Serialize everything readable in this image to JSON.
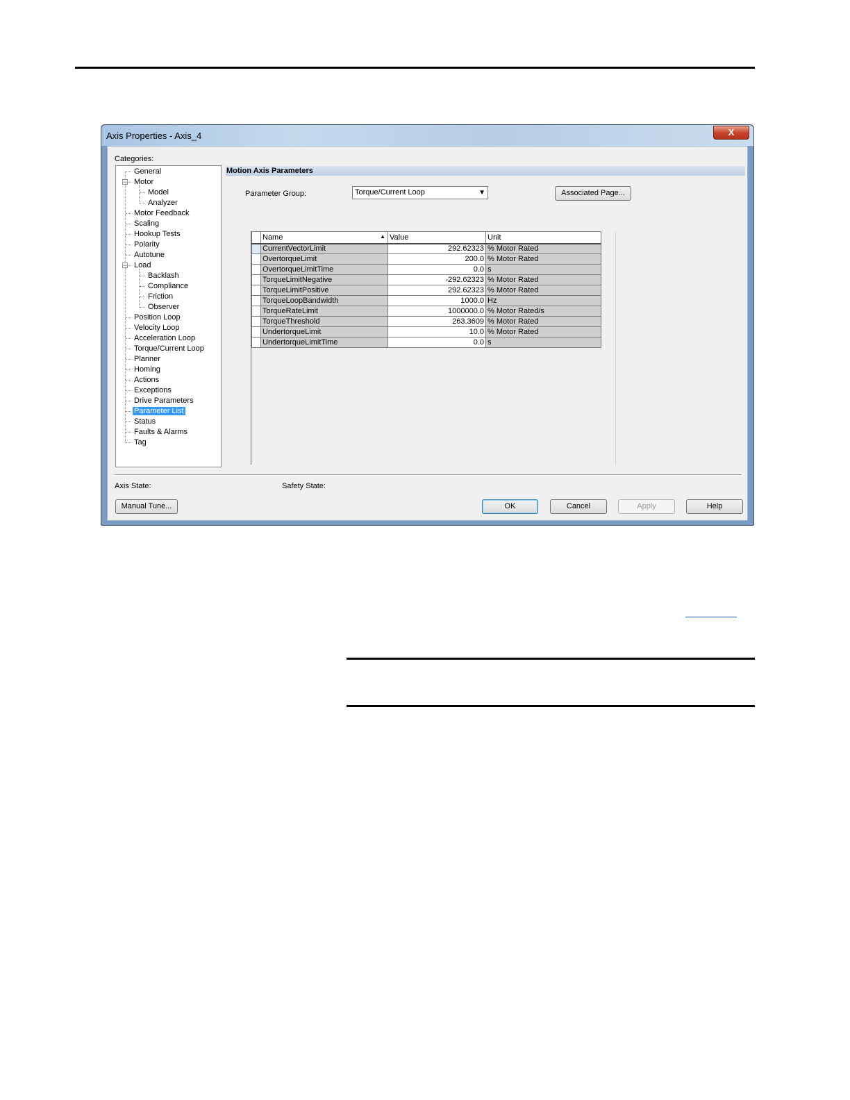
{
  "window": {
    "title": "Axis Properties - Axis_4",
    "close_label": "X"
  },
  "categories": {
    "label": "Categories:",
    "items": [
      {
        "label": "General"
      },
      {
        "label": "Motor"
      },
      {
        "label": "Model"
      },
      {
        "label": "Analyzer"
      },
      {
        "label": "Motor Feedback"
      },
      {
        "label": "Scaling"
      },
      {
        "label": "Hookup Tests"
      },
      {
        "label": "Polarity"
      },
      {
        "label": "Autotune"
      },
      {
        "label": "Load"
      },
      {
        "label": "Backlash"
      },
      {
        "label": "Compliance"
      },
      {
        "label": "Friction"
      },
      {
        "label": "Observer"
      },
      {
        "label": "Position Loop"
      },
      {
        "label": "Velocity Loop"
      },
      {
        "label": "Acceleration Loop"
      },
      {
        "label": "Torque/Current Loop"
      },
      {
        "label": "Planner"
      },
      {
        "label": "Homing"
      },
      {
        "label": "Actions"
      },
      {
        "label": "Exceptions"
      },
      {
        "label": "Drive Parameters"
      },
      {
        "label": "Parameter List"
      },
      {
        "label": "Status"
      },
      {
        "label": "Faults & Alarms"
      },
      {
        "label": "Tag"
      }
    ],
    "selected": "Parameter List"
  },
  "panel": {
    "header": "Motion Axis Parameters",
    "parameter_group_label": "Parameter Group:",
    "parameter_group_value": "Torque/Current Loop",
    "associated_page_label": "Associated Page..."
  },
  "grid": {
    "columns": [
      "Name",
      "Value",
      "Unit"
    ],
    "rows": [
      {
        "name": "CurrentVectorLimit",
        "value": "292.62323",
        "unit": "% Motor Rated"
      },
      {
        "name": "OvertorqueLimit",
        "value": "200.0",
        "unit": "% Motor Rated"
      },
      {
        "name": "OvertorqueLimitTime",
        "value": "0.0",
        "unit": "s"
      },
      {
        "name": "TorqueLimitNegative",
        "value": "-292.62323",
        "unit": "% Motor Rated"
      },
      {
        "name": "TorqueLimitPositive",
        "value": "292.62323",
        "unit": "% Motor Rated"
      },
      {
        "name": "TorqueLoopBandwidth",
        "value": "1000.0",
        "unit": "Hz"
      },
      {
        "name": "TorqueRateLimit",
        "value": "1000000.0",
        "unit": "% Motor Rated/s"
      },
      {
        "name": "TorqueThreshold",
        "value": "263.3609",
        "unit": "% Motor Rated"
      },
      {
        "name": "UndertorqueLimit",
        "value": "10.0",
        "unit": "% Motor Rated"
      },
      {
        "name": "UndertorqueLimitTime",
        "value": "0.0",
        "unit": "s"
      }
    ]
  },
  "footer": {
    "axis_state_label": "Axis State:",
    "safety_state_label": "Safety State:",
    "manual_tune_label": "Manual Tune...",
    "ok_label": "OK",
    "cancel_label": "Cancel",
    "apply_label": "Apply",
    "help_label": "Help"
  }
}
